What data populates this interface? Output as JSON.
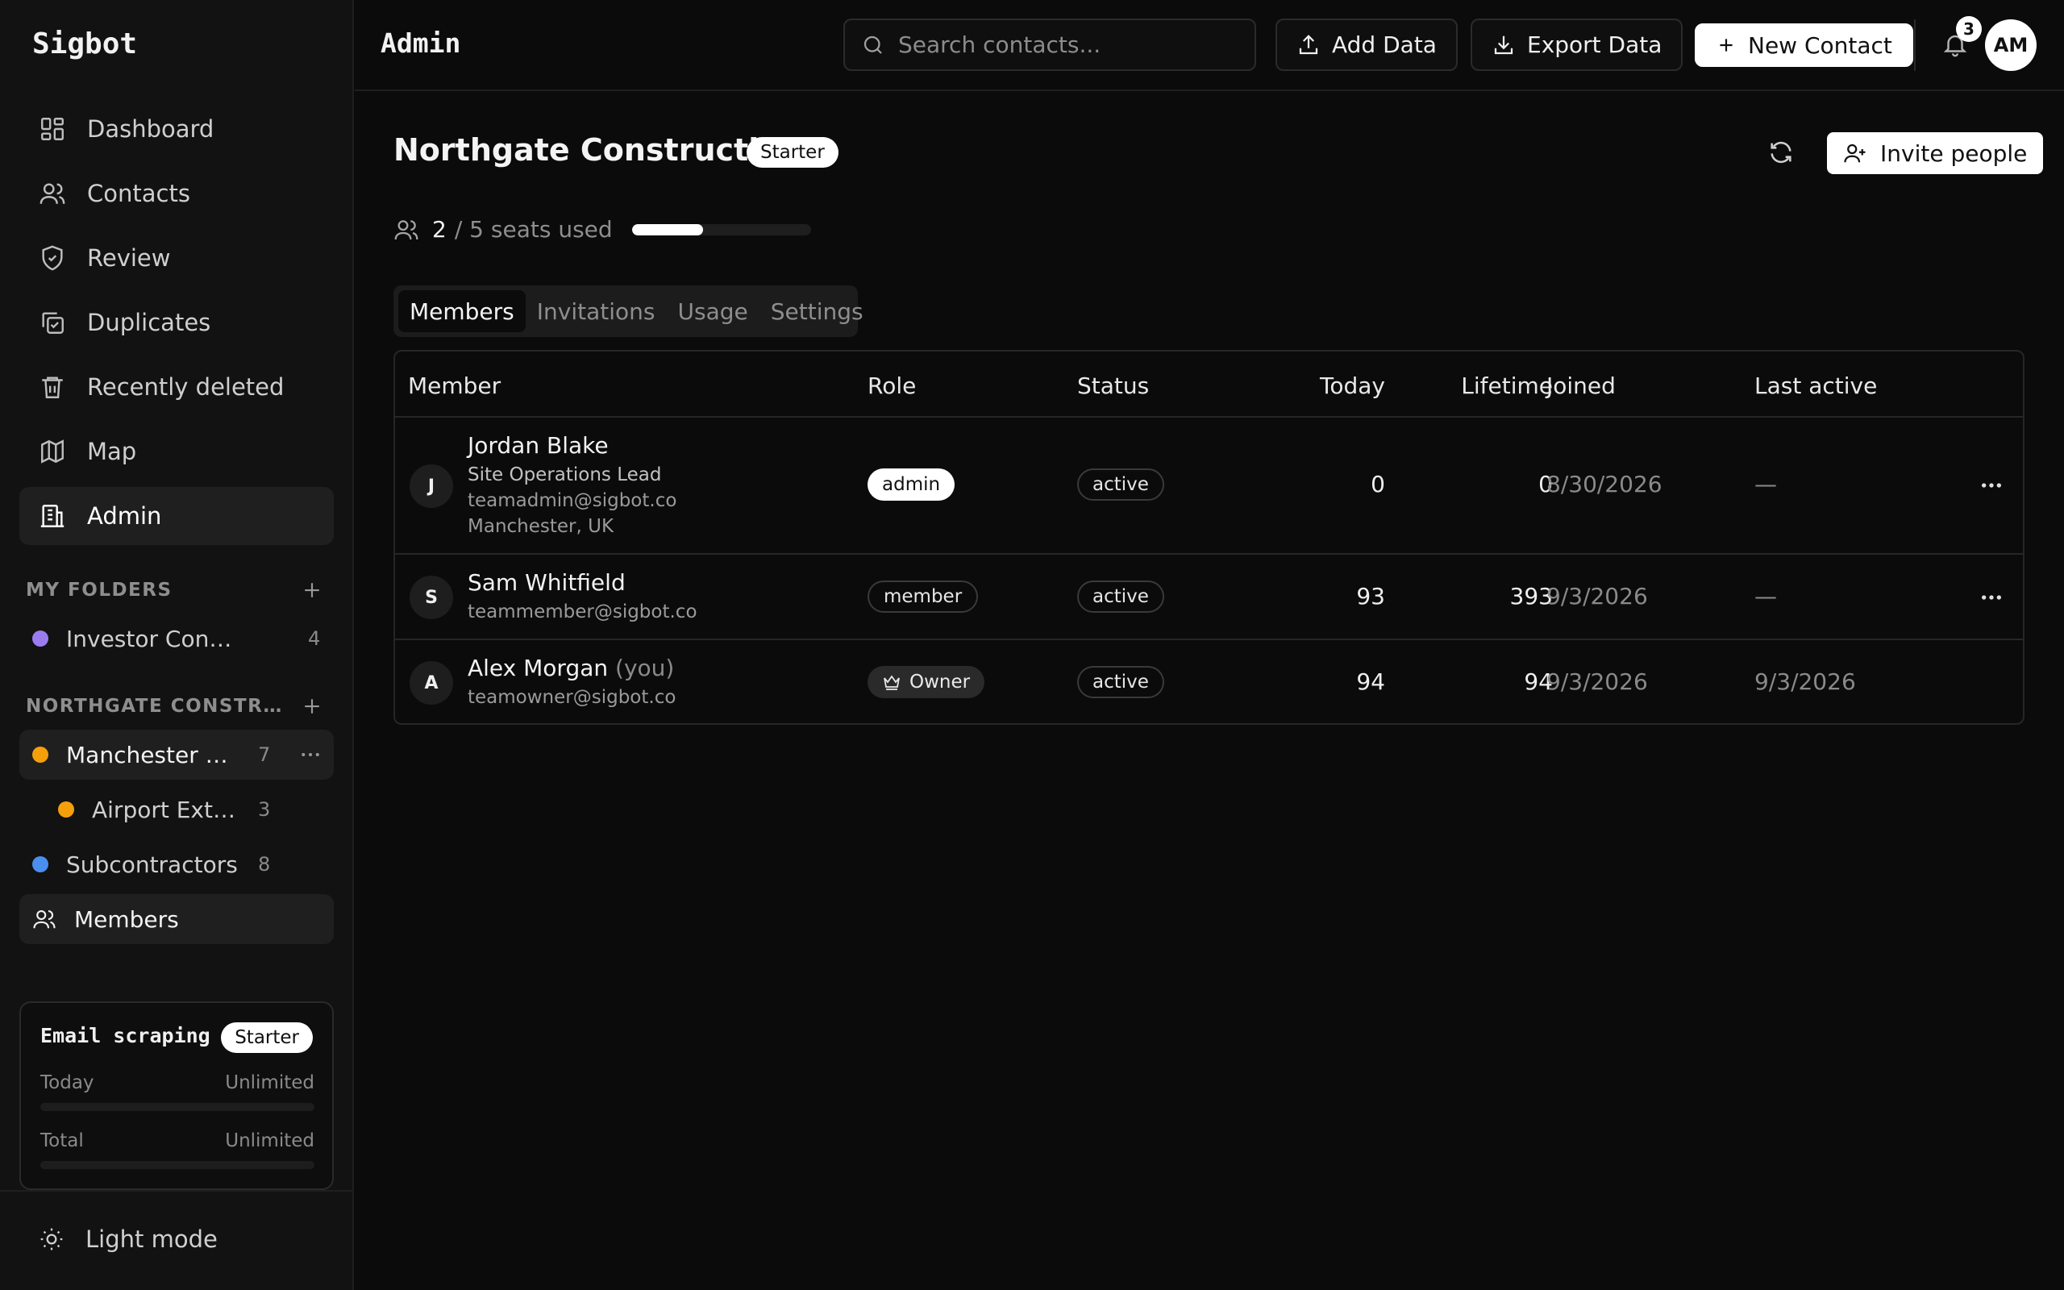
{
  "app": {
    "brand": "Sigbot",
    "page_title": "Admin"
  },
  "sidebar": {
    "nav": [
      {
        "label": "Dashboard",
        "icon": "dashboard-icon"
      },
      {
        "label": "Contacts",
        "icon": "users-icon"
      },
      {
        "label": "Review",
        "icon": "shield-icon"
      },
      {
        "label": "Duplicates",
        "icon": "duplicates-icon"
      },
      {
        "label": "Recently deleted",
        "icon": "trash-icon"
      },
      {
        "label": "Map",
        "icon": "map-icon"
      },
      {
        "label": "Admin",
        "icon": "building-icon",
        "active": true
      }
    ],
    "my_folders": {
      "title": "MY FOLDERS",
      "items": [
        {
          "name": "Investor Contacts",
          "count": "4",
          "color": "#9b7cf0"
        }
      ]
    },
    "org_folders": {
      "title": "NORTHGATE CONSTRUCTION",
      "items": [
        {
          "name": "Manchester Client Projects",
          "count": "7",
          "color": "#f59f0b"
        },
        {
          "name": "Airport Extension",
          "count": "3",
          "color": "#f59f0b"
        },
        {
          "name": "Subcontractors",
          "count": "8",
          "color": "#4a8ff0"
        }
      ],
      "members_label": "Members"
    },
    "usage_card": {
      "title": "Email scraping",
      "plan": "Starter",
      "rows": [
        {
          "label": "Today",
          "value": "Unlimited"
        },
        {
          "label": "Total",
          "value": "Unlimited"
        }
      ]
    },
    "light_mode_label": "Light mode"
  },
  "topbar": {
    "search_placeholder": "Search contacts...",
    "add_data": "Add Data",
    "export_data": "Export Data",
    "new_contact": "New Contact",
    "notification_count": "3",
    "avatar_initials": "AM"
  },
  "org": {
    "name": "Northgate Construction",
    "plan": "Starter",
    "invite_label": "Invite people",
    "seats_used": "2",
    "seats_rest": "/ 5 seats used",
    "seats_fraction": 0.4
  },
  "tabs": [
    "Members",
    "Invitations",
    "Usage",
    "Settings"
  ],
  "table": {
    "headers": {
      "member": "Member",
      "role": "Role",
      "status": "Status",
      "today": "Today",
      "lifetime": "Lifetime",
      "joined": "Joined",
      "last_active": "Last active"
    },
    "rows": [
      {
        "initial": "J",
        "name": "Jordan Blake",
        "you": "",
        "title": "Site Operations Lead",
        "email": "teamadmin@sigbot.co",
        "location": "Manchester, UK",
        "role": "admin",
        "status": "active",
        "today": "0",
        "lifetime": "0",
        "joined": "8/30/2026",
        "last_active": "—"
      },
      {
        "initial": "S",
        "name": "Sam Whitfield",
        "you": "",
        "email": "teammember@sigbot.co",
        "role": "member",
        "status": "active",
        "today": "93",
        "lifetime": "393",
        "joined": "9/3/2026",
        "last_active": "—"
      },
      {
        "initial": "A",
        "name": "Alex Morgan",
        "you": "(you)",
        "email": "teamowner@sigbot.co",
        "role": "Owner",
        "status": "active",
        "today": "94",
        "lifetime": "94",
        "joined": "9/3/2026",
        "last_active": "9/3/2026"
      }
    ]
  }
}
